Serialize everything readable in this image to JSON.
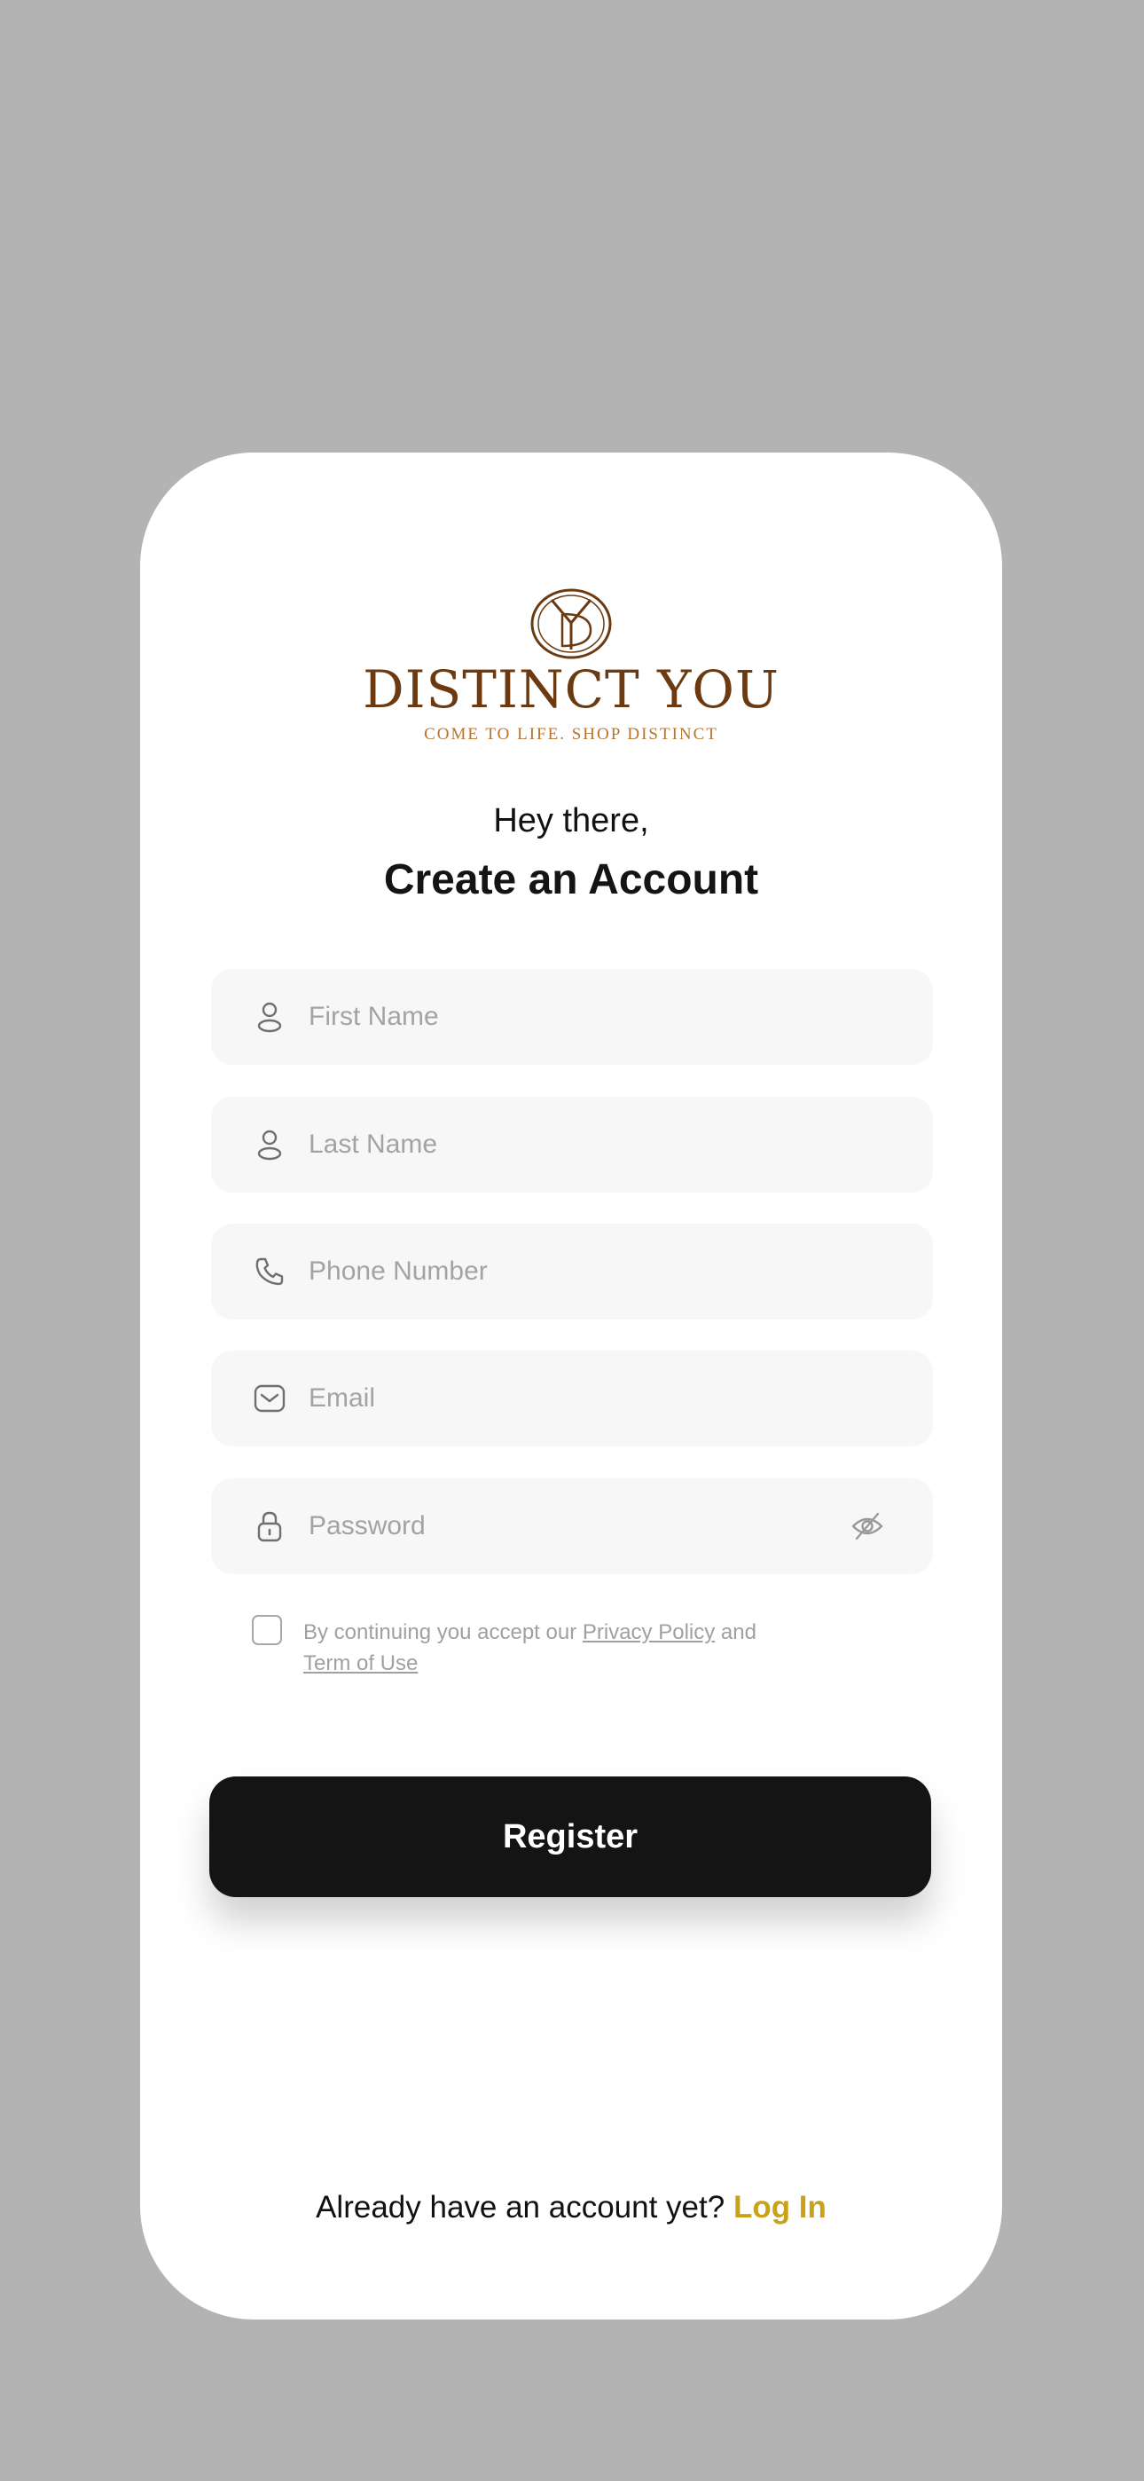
{
  "brand": {
    "wordmark": "DISTINCT YOU",
    "tagline": "COME TO LIFE. SHOP DISTINCT",
    "colors": {
      "wordmark": "#6b3a10",
      "tagline": "#b8742c",
      "accent": "#c9a21a",
      "button": "#141414"
    }
  },
  "header": {
    "greeting": "Hey there,",
    "title": "Create an Account"
  },
  "form": {
    "first_name": {
      "placeholder": "First Name",
      "icon": "user-icon"
    },
    "last_name": {
      "placeholder": "Last Name",
      "icon": "user-icon"
    },
    "phone": {
      "placeholder": "Phone Number",
      "icon": "phone-icon"
    },
    "email": {
      "placeholder": "Email",
      "icon": "mail-icon"
    },
    "password": {
      "placeholder": "Password",
      "icon": "lock-icon",
      "toggle_icon": "eye-off-icon"
    }
  },
  "terms": {
    "prefix": "By continuing you accept our ",
    "privacy_link": "Privacy Policy",
    "middle": " and ",
    "terms_link": "Term of Use",
    "checked": false
  },
  "actions": {
    "register_label": "Register"
  },
  "footer": {
    "prompt": "Already have an account yet? ",
    "login_label": "Log In"
  }
}
